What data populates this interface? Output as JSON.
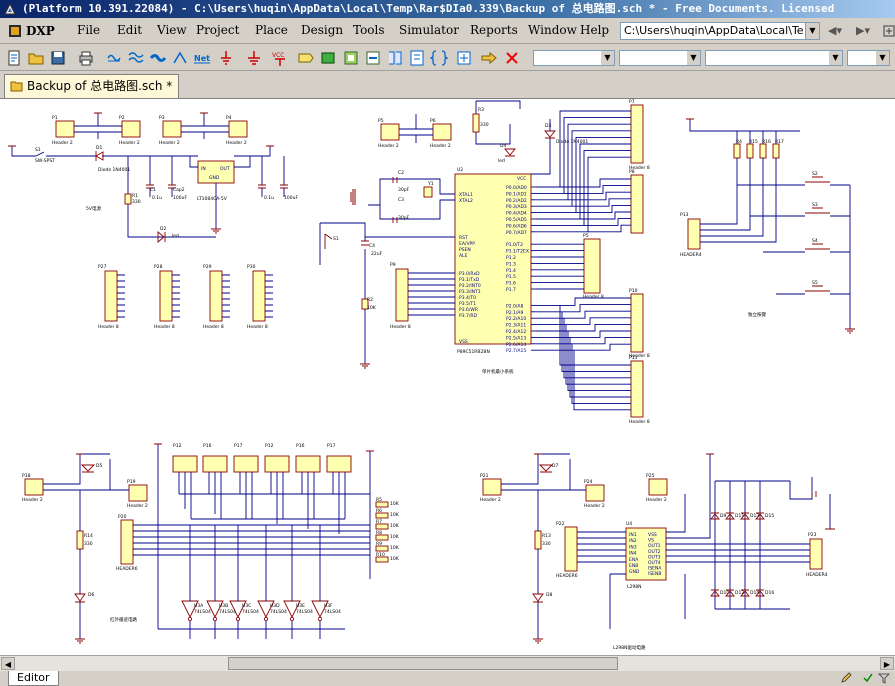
{
  "window": {
    "title": "(Platform 10.391.22084) - C:\\Users\\huqin\\AppData\\Local\\Temp\\Rar$DIa0.339\\Backup of 总电路图.sch * - Free Documents. Licensed"
  },
  "menubar": {
    "dxp_label": "DXP",
    "items": [
      "File",
      "Edit",
      "View",
      "Project",
      "Place",
      "Design",
      "Tools",
      "Simulator",
      "Reports",
      "Window",
      "Help"
    ],
    "path_value": "C:\\Users\\huqin\\AppData\\Local\\Te"
  },
  "document_tab": {
    "label": "Backup of 总电路图.sch *"
  },
  "status": {
    "editor_tab": "Editor"
  },
  "schematic": {
    "headers": {
      "p1": "P1",
      "p2": "P2",
      "p3": "P3",
      "p4": "P4",
      "p5": "P5",
      "p6": "P6",
      "p7": "P7",
      "p8": "P8",
      "p9": "P9",
      "p10": "P10",
      "p11": "P11",
      "p12": "P12",
      "p13": "P13",
      "p14": "P14",
      "p15": "P15",
      "p16": "P16",
      "p17": "P17",
      "p18": "P18",
      "p19": "P19",
      "p20": "P20",
      "p21": "P21",
      "p22": "P22",
      "p23": "P23",
      "p24": "P24",
      "p25": "P25",
      "p26": "P26",
      "p27": "P27",
      "p28": "P28",
      "p29": "P29",
      "p30": "P30",
      "header_label": "Header 2",
      "header8_label": "Header 8",
      "header6_label": "HEADER6",
      "header4_label": "HEADER4"
    },
    "u1": {
      "ref": "U1",
      "in": "IN",
      "out": "OUT",
      "gnd": "GND",
      "part": "LT1084CA-5V"
    },
    "u2": {
      "ref": "U2",
      "part": "P89C51RB2BN",
      "pins_left": [
        "XTAL1",
        "XTAL2",
        "RST",
        "EA/VPP",
        "PSEN",
        "ALE",
        "P3.0/RxD",
        "P3.1/TxD",
        "P3.2/INT0",
        "P3.3/INT1",
        "P3.4/T0",
        "P3.5/T1",
        "P3.6/WR",
        "P3.7/RD"
      ],
      "pins_right": [
        "P0.0/AD0",
        "P0.1/AD1",
        "P0.2/AD2",
        "P0.3/AD3",
        "P0.4/AD4",
        "P0.5/AD5",
        "P0.6/AD6",
        "P0.7/AD7",
        "P1.0/T2",
        "P1.1/T2EX",
        "P1.2",
        "P1.3",
        "P1.4",
        "P1.5",
        "P1.6",
        "P1.7",
        "P2.0/A8",
        "P2.1/A9",
        "P2.2/A10",
        "P2.3/A11",
        "P2.4/A12",
        "P2.5/A13",
        "P2.6/A14",
        "P2.7/A15"
      ],
      "vcc": "VCC",
      "vss": "VSS"
    },
    "u4": {
      "ref": "U4",
      "part": "L298N",
      "pins_left": [
        "IN1",
        "IN2",
        "IN3",
        "IN4",
        "ENA",
        "ENB",
        "GND"
      ],
      "pins_right": [
        "VSS",
        "VS",
        "OUT1",
        "OUT2",
        "OUT3",
        "OUT4",
        "ISENA",
        "ISENB"
      ]
    },
    "labels": {
      "s1": "S1",
      "sw": "SW-SPST",
      "d1": "D1",
      "d1_part": "Diode 1N4001",
      "d2": "D2",
      "d2_part": "led",
      "d3": "D3",
      "d4": "D4",
      "d5": "D5",
      "d6": "D6",
      "d7": "D7",
      "d8": "D8",
      "r1": "R1",
      "r1_val": "330",
      "r2": "R2",
      "r2_val": "10K",
      "r3": "R3",
      "r3_val": "330",
      "r13": "R13",
      "r13_val": "330",
      "r14": "R14",
      "r14_val": "330",
      "c1": "C1",
      "c2": "C2",
      "c3": "C3",
      "c4": "C4",
      "cap_val": "0.1u",
      "cap_pol": "Cap2",
      "cap_pol_val": "100uF",
      "cap_small": "30pF",
      "cap_rst": "22uF",
      "xtal": "Y1",
      "vcc": "VCC",
      "power_block": "5V电源",
      "mcu_block": "单片机最小系统",
      "key_block": "独立按键",
      "ir_block": "红外循迹电路",
      "l298_block": "L298N驱动电路",
      "res_val": "10K",
      "res_refs": [
        "R5",
        "R6",
        "R7",
        "R8",
        "R9",
        "R10",
        "R11",
        "R12"
      ],
      "buf_part": "74LS04",
      "buf_refs": [
        "U3A",
        "U3B",
        "U3C",
        "U3D",
        "U3E",
        "U3F"
      ],
      "keys": [
        "S2",
        "S3",
        "S4",
        "S5"
      ],
      "pull_res": [
        "R4",
        "R15",
        "R16",
        "R17"
      ],
      "diodes_bridge": [
        "D9",
        "D10",
        "D11",
        "D12",
        "D13",
        "D14",
        "D15",
        "D16"
      ],
      "diode_part": "Diode 1N4007"
    }
  }
}
